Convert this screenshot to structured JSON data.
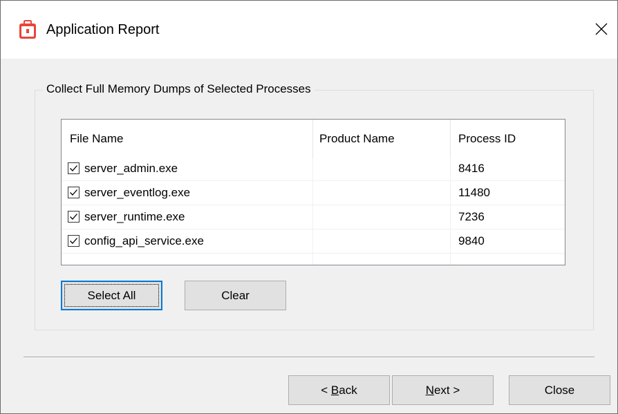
{
  "window": {
    "title": "Application Report",
    "app_icon": "toolbox-icon",
    "close_icon": "close-icon",
    "brand_color": "#e8453c"
  },
  "group": {
    "label": "Collect Full Memory Dumps of Selected Processes"
  },
  "table": {
    "columns": [
      "File Name",
      "Product Name",
      "Process ID"
    ],
    "rows": [
      {
        "checked": true,
        "file_name": "server_admin.exe",
        "product_name": "",
        "process_id": "8416"
      },
      {
        "checked": true,
        "file_name": "server_eventlog.exe",
        "product_name": "",
        "process_id": "11480"
      },
      {
        "checked": true,
        "file_name": "server_runtime.exe",
        "product_name": "",
        "process_id": "7236"
      },
      {
        "checked": true,
        "file_name": "config_api_service.exe",
        "product_name": "",
        "process_id": "9840"
      }
    ]
  },
  "actions": {
    "select_all": "Select All",
    "clear": "Clear"
  },
  "footer": {
    "back_mnemonic": "B",
    "back_prefix": "< ",
    "back_rest": "ack",
    "next_mnemonic": "N",
    "next_rest": "ext >",
    "close": "Close"
  },
  "colors": {
    "accent": "#0078d7",
    "button_face": "#e1e1e1"
  }
}
